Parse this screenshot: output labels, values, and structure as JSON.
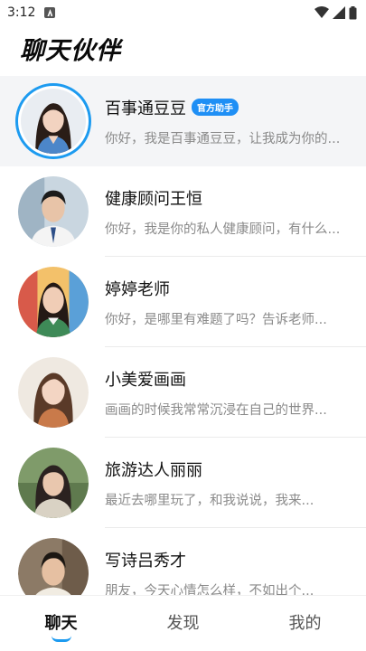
{
  "status_bar": {
    "time": "3:12"
  },
  "header": {
    "title": "聊天伙伴"
  },
  "chats": [
    {
      "name": "百事通豆豆",
      "badge": "官方助手",
      "preview": "你好，我是百事通豆豆，让我成为你的..."
    },
    {
      "name": "健康顾问王恒",
      "preview": "你好，我是你的私人健康顾问，有什么..."
    },
    {
      "name": "婷婷老师",
      "preview": "你好，是哪里有难题了吗？告诉老师..."
    },
    {
      "name": "小美爱画画",
      "preview": "画画的时候我常常沉浸在自己的世界..."
    },
    {
      "name": "旅游达人丽丽",
      "preview": "最近去哪里玩了，和我说说，我来..."
    },
    {
      "name": "写诗吕秀才",
      "preview": "朋友，今天心情怎么样，不如出个..."
    }
  ],
  "tabs": [
    {
      "label": "聊天"
    },
    {
      "label": "发现"
    },
    {
      "label": "我的"
    }
  ],
  "colors": {
    "accent": "#1d9bf0",
    "badge": "#1f8ff5"
  }
}
